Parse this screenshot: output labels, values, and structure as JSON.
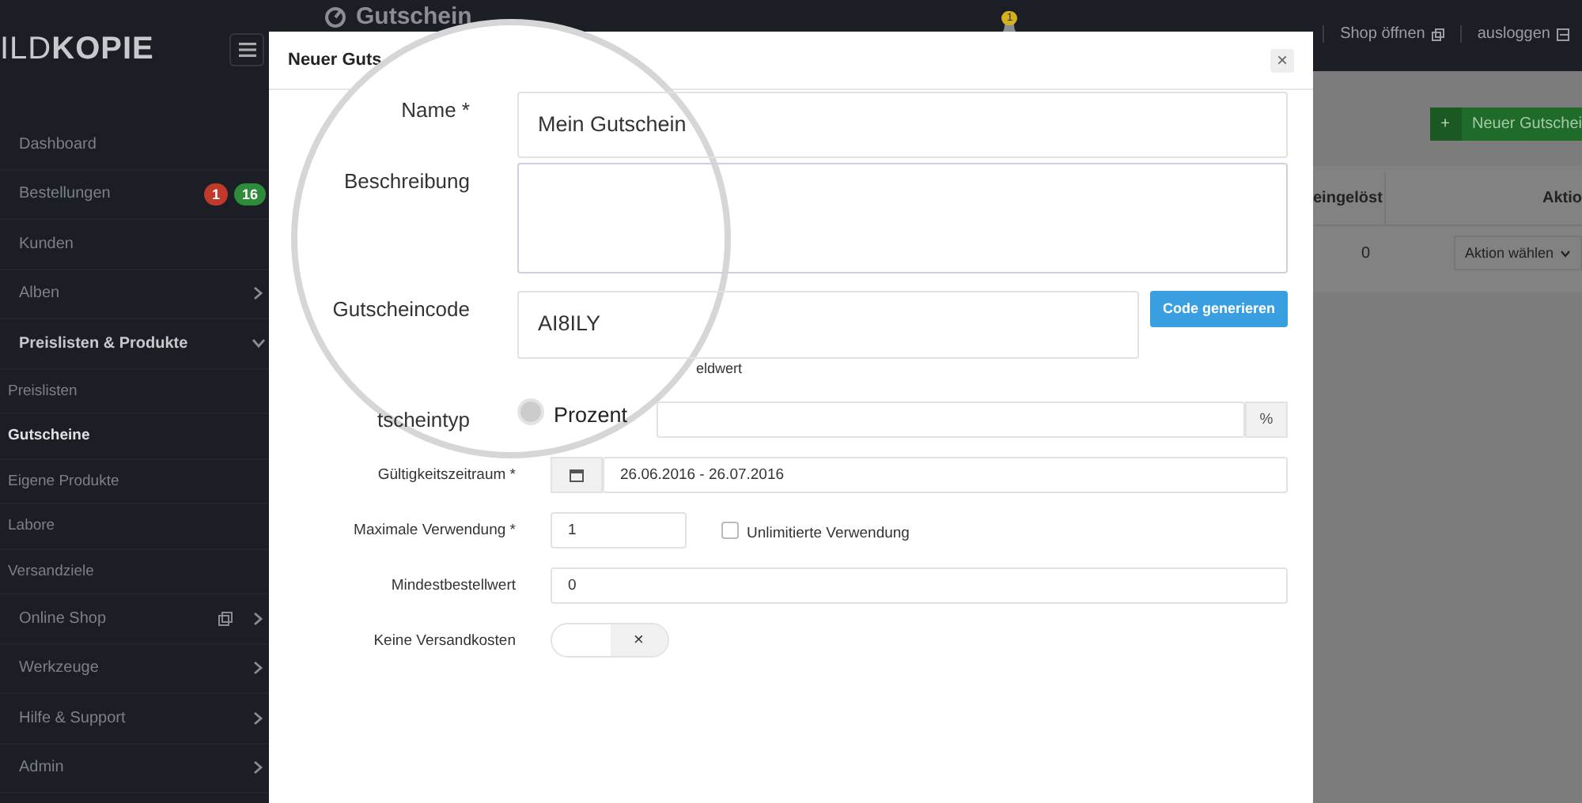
{
  "sidebar": {
    "logo": "ILD**KOPIE**",
    "items": [
      {
        "label": "Dashboard"
      },
      {
        "label": "Bestellungen",
        "badges": [
          {
            "text": "1",
            "color": "#c0392b"
          },
          {
            "text": "16",
            "color": "#2e8b3a"
          }
        ]
      },
      {
        "label": "Kunden"
      },
      {
        "label": "Alben",
        "expanded": false
      },
      {
        "label": "Preislisten & Produkte",
        "expanded": true,
        "children": [
          {
            "label": "Preislisten",
            "selected": false
          },
          {
            "label": "Gutscheine",
            "selected": true
          },
          {
            "label": "Eigene Produkte",
            "selected": false
          },
          {
            "label": "Labore",
            "selected": false
          },
          {
            "label": "Versandziele",
            "selected": false
          }
        ]
      },
      {
        "label": "Online Shop",
        "expanded": false,
        "external": true
      },
      {
        "label": "Werkzeuge",
        "expanded": false
      },
      {
        "label": "Hilfe & Support",
        "expanded": false
      },
      {
        "label": "Admin",
        "expanded": false
      }
    ]
  },
  "topbar": {
    "title": "Gutschein",
    "notifications": "1",
    "links": [
      {
        "label": "Shop öffnen",
        "kind": "external"
      },
      {
        "label": "ausloggen",
        "kind": "logout"
      }
    ]
  },
  "content": {
    "new_button": {
      "icon": "+",
      "label": "Neuer Gutschei"
    },
    "table": {
      "columns": [
        "eingelöst",
        "Aktio"
      ],
      "rows": [
        {
          "cells": [
            "0"
          ],
          "action": "Aktion wählen"
        }
      ]
    }
  },
  "modal": {
    "title": "Neuer Guts",
    "close": "×",
    "fields": [
      {
        "kind": "text",
        "label": "Name *",
        "value": "Mein Gutschein",
        "magnified": true
      },
      {
        "kind": "textarea",
        "label": "Beschreibung",
        "magnified": true
      },
      {
        "kind": "code",
        "label": "Gutscheincode",
        "value": "AI8ILY",
        "button": "Code generieren",
        "hint": "eldwert",
        "magnified": true
      },
      {
        "kind": "radio",
        "label": "tscheintyp",
        "options": [
          {
            "label": "Prozent",
            "selected": false
          }
        ],
        "addon": "%",
        "magnified": true
      },
      {
        "kind": "date",
        "label": "Gültigkeitszeitraum *",
        "value": "26.06.2016 - 26.07.2016",
        "magnified": false
      },
      {
        "kind": "number",
        "label": "Maximale Verwendung *",
        "value": "1",
        "check": {
          "label": "Unlimitierte Verwendung",
          "checked": false
        },
        "magnified": false
      },
      {
        "kind": "text",
        "label": "Mindestbestellwert",
        "value": "0",
        "magnified": false
      },
      {
        "kind": "toggle",
        "label": "Keine Versandkosten",
        "on": false,
        "off_text": "×",
        "magnified": false
      }
    ]
  }
}
